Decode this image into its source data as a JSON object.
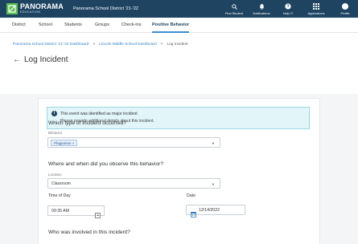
{
  "app": {
    "logo_name": "PANORAMA",
    "logo_sub": "EDUCATION",
    "district": "Panorama School District '21-'22",
    "brand_colors": {
      "header": "#1e4462",
      "logo": "#5cbf4f",
      "link": "#2f7fc1"
    }
  },
  "top_actions": [
    {
      "label": "Find Student",
      "icon": "search-icon"
    },
    {
      "label": "Notifications",
      "icon": "bell-icon"
    },
    {
      "label": "Help IT",
      "icon": "help-icon"
    },
    {
      "label": "Applications",
      "icon": "grid-icon"
    },
    {
      "label": "Profile",
      "icon": "avatar-icon"
    }
  ],
  "nav": {
    "items": [
      "District",
      "School",
      "Students",
      "Groups",
      "Check-ins",
      "Positive Behavior"
    ],
    "active": "Positive Behavior"
  },
  "breadcrumb": {
    "items": [
      "Panorama School District '21-'22 Dashboard",
      "Lincoln Middle School Dashboard",
      "Log Incident"
    ],
    "separator": ">"
  },
  "page": {
    "title": "Log Incident",
    "back_icon": "arrow-left-icon"
  },
  "alert": {
    "title": "This event was identified as major incident",
    "body": "Please provide additional details about this incident.",
    "icon": "info-icon"
  },
  "form": {
    "q1": "Which type of incident occurred?",
    "behavior_label": "Behavior",
    "behavior_chip": "Plagiarism ×",
    "q2": "Where and when did you observe this behavior?",
    "location_label": "Location",
    "location_value": "Classroom",
    "time_label": "Time of Day",
    "time_value": "09:35 AM",
    "date_label": "Date",
    "date_value": "12/14/2022",
    "q3": "Who was involved in this incident?"
  }
}
